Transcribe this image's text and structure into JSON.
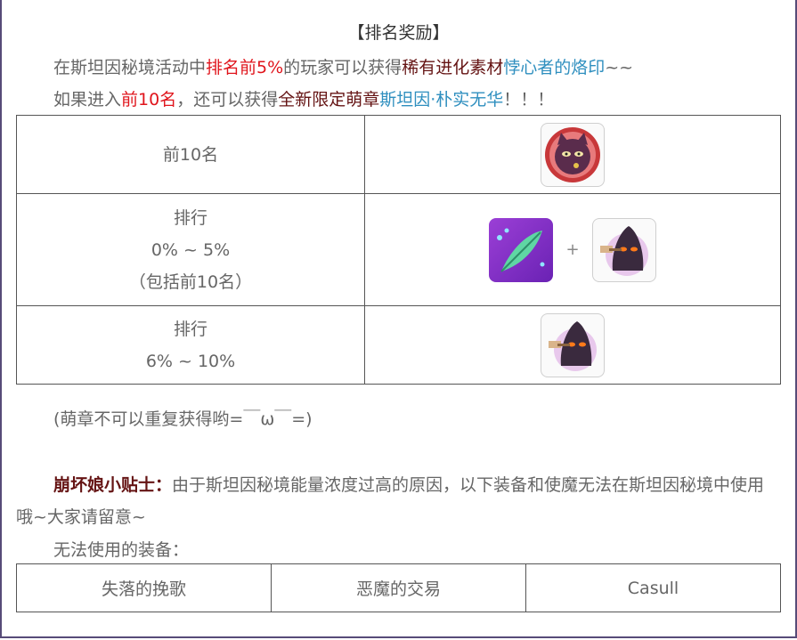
{
  "title": "【排名奖励】",
  "intro": {
    "line1": {
      "p1": "在斯坦因秘境活动中",
      "p2": "排名前5%",
      "p3": "的玩家可以获得",
      "p4": "稀有进化素材",
      "p5": "悖心者的烙印",
      "p6": "~~"
    },
    "line2": {
      "p1": "如果进入",
      "p2": "前10名",
      "p3": "，还可以获得",
      "p4": "全新限定萌章",
      "p5": "斯坦因·朴实无华",
      "p6": "！！！"
    }
  },
  "rewards": [
    {
      "line1": "前10名",
      "line2": "",
      "line3": "",
      "icons": [
        "cat-badge-icon"
      ]
    },
    {
      "line1": "排行",
      "line2": "0% ~ 5%",
      "line3": "（包括前10名）",
      "icons": [
        "green-feather-icon",
        "hooded-hammer-icon"
      ]
    },
    {
      "line1": "排行",
      "line2": "6% ~ 10%",
      "line3": "",
      "icons": [
        "hooded-hammer-icon"
      ]
    }
  ],
  "plus_sign": "+",
  "note": "(萌章不可以重复获得哟=￣ω￣=)",
  "tip": {
    "title": "崩坏娘小贴士：",
    "text": "由于斯坦因秘境能量浓度过高的原因，以下装备和使魔无法在斯坦因秘境中使用哦~大家请留意~"
  },
  "cannot_use": "无法使用的装备：",
  "equipment": [
    "失落的挽歌",
    "恶魔的交易",
    "Casull"
  ],
  "colors": {
    "border": "#574b78",
    "highlight_red": "#e0151c",
    "highlight_dark": "#651414",
    "highlight_blue": "#2f8fbf"
  }
}
